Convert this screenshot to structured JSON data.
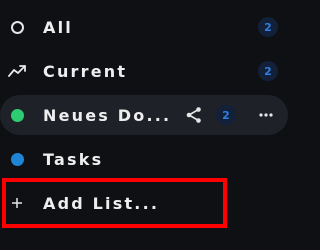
{
  "lists": {
    "all": {
      "label": "All",
      "count": "2",
      "icon": "circle-outline-icon"
    },
    "current": {
      "label": "Current",
      "count": "2",
      "icon": "trending-up-icon"
    },
    "neues": {
      "label": "Neues Do...",
      "count": "2",
      "color": "#2ecc71",
      "icon": "green-dot-icon"
    },
    "tasks": {
      "label": "Tasks",
      "color": "#1f86d6",
      "icon": "blue-dot-icon"
    }
  },
  "add_list": {
    "label": "Add List...",
    "icon": "plus-icon"
  },
  "colors": {
    "background": "#0f1013",
    "active_row": "#1e2228",
    "badge_bg": "#12203a",
    "badge_text": "#2f7ee0",
    "highlight": "#ff0000"
  }
}
